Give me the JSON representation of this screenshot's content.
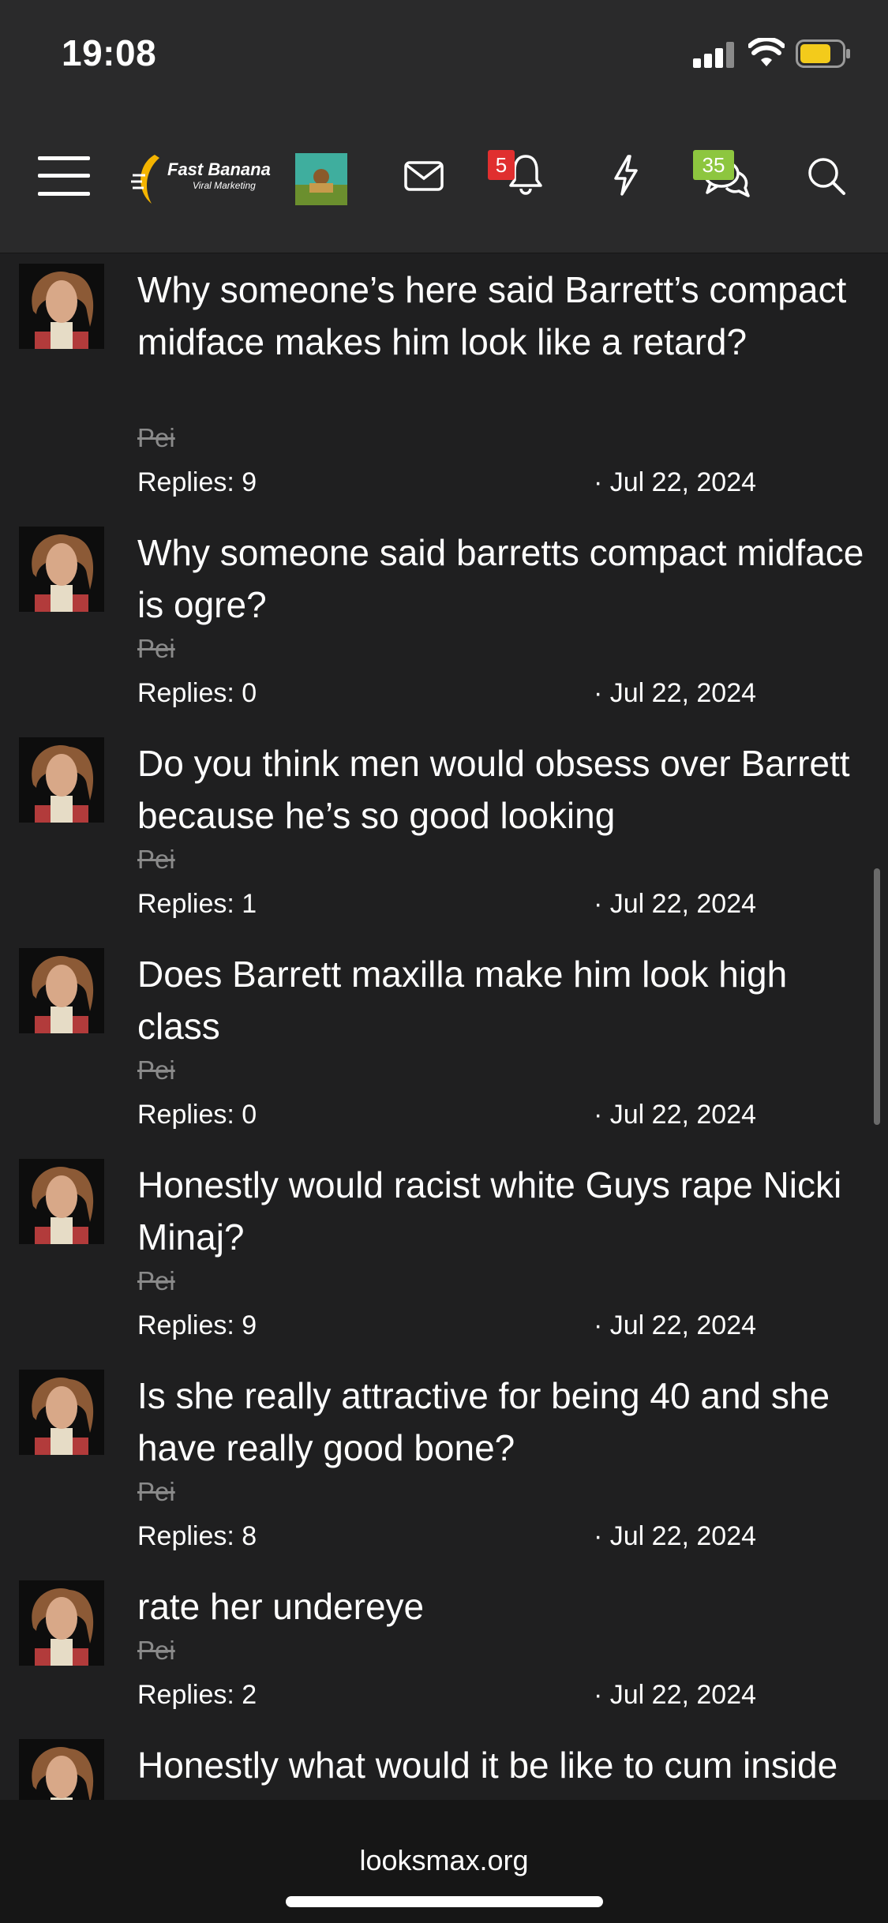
{
  "status_bar": {
    "time": "19:08"
  },
  "nav": {
    "logo_text": "Fast Banana",
    "logo_subtext": "Viral Marketing",
    "alerts_badge": "5",
    "conversations_badge": "35"
  },
  "threads": [
    {
      "title": "Why someone’s here said Barrett’s compact midface makes him look like a retard?",
      "author": "Pei",
      "replies": "Replies: 9",
      "date": "· Jul 22, 2024"
    },
    {
      "title": "Why someone said barretts compact midface is ogre?",
      "author": "Pei",
      "replies": "Replies: 0",
      "date": "· Jul 22, 2024"
    },
    {
      "title": "Do you think men would obsess over Barrett because he’s so good looking",
      "author": "Pei",
      "replies": "Replies: 1",
      "date": "· Jul 22, 2024"
    },
    {
      "title": "Does Barrett maxilla make him look high class",
      "author": "Pei",
      "replies": "Replies: 0",
      "date": "· Jul 22, 2024"
    },
    {
      "title": "Honestly would racist white Guys rape Nicki Minaj?",
      "author": "Pei",
      "replies": "Replies: 9",
      "date": "· Jul 22, 2024"
    },
    {
      "title": "Is she really attractive for being 40 and she have really good bone?",
      "author": "Pei",
      "replies": "Replies: 8",
      "date": "· Jul 22, 2024"
    },
    {
      "title": "rate her undereye",
      "author": "Pei",
      "replies": "Replies: 2",
      "date": "· Jul 22, 2024"
    },
    {
      "title": "Honestly what would it be like to cum inside"
    }
  ],
  "browser": {
    "url": "looksmax.org"
  }
}
